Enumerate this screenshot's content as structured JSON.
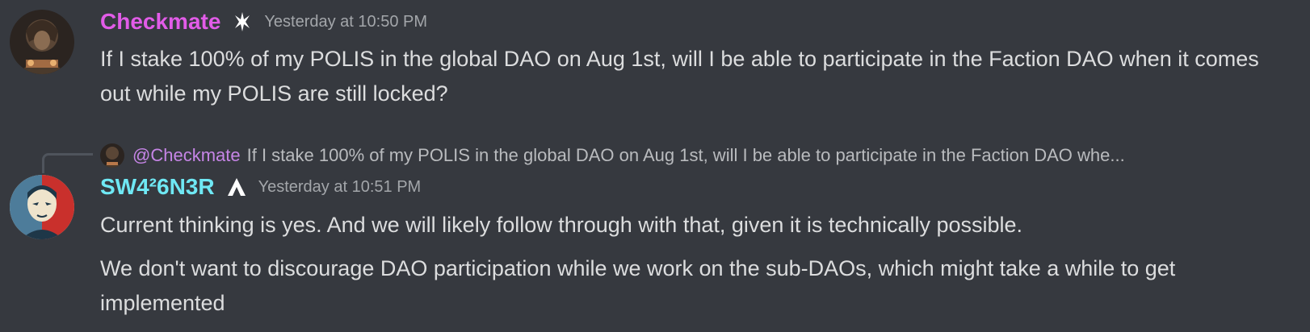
{
  "messages": [
    {
      "username": "Checkmate",
      "username_color": "#e25ce8",
      "badge_icon": "fencer-badge-icon",
      "timestamp": "Yesterday at 10:50 PM",
      "lines": [
        "If I stake 100% of my POLIS in the global DAO on Aug 1st, will I be able to participate in the Faction DAO when it comes out while my POLIS are still locked?"
      ]
    },
    {
      "reply_to": {
        "mention": "@Checkmate",
        "preview": "If I stake 100% of my POLIS in the global DAO on Aug 1st, will I be able to participate in the Faction DAO whe..."
      },
      "username": "SW4²6N3R",
      "username_color": "#6fe8f4",
      "badge_icon": "a-logo-badge-icon",
      "timestamp": "Yesterday at 10:51 PM",
      "lines": [
        "Current thinking is yes. And we will likely follow through with that, given it is technically possible.",
        "We don't want to discourage DAO participation while we work on the sub-DAOs, which might take a while to get implemented"
      ]
    }
  ]
}
